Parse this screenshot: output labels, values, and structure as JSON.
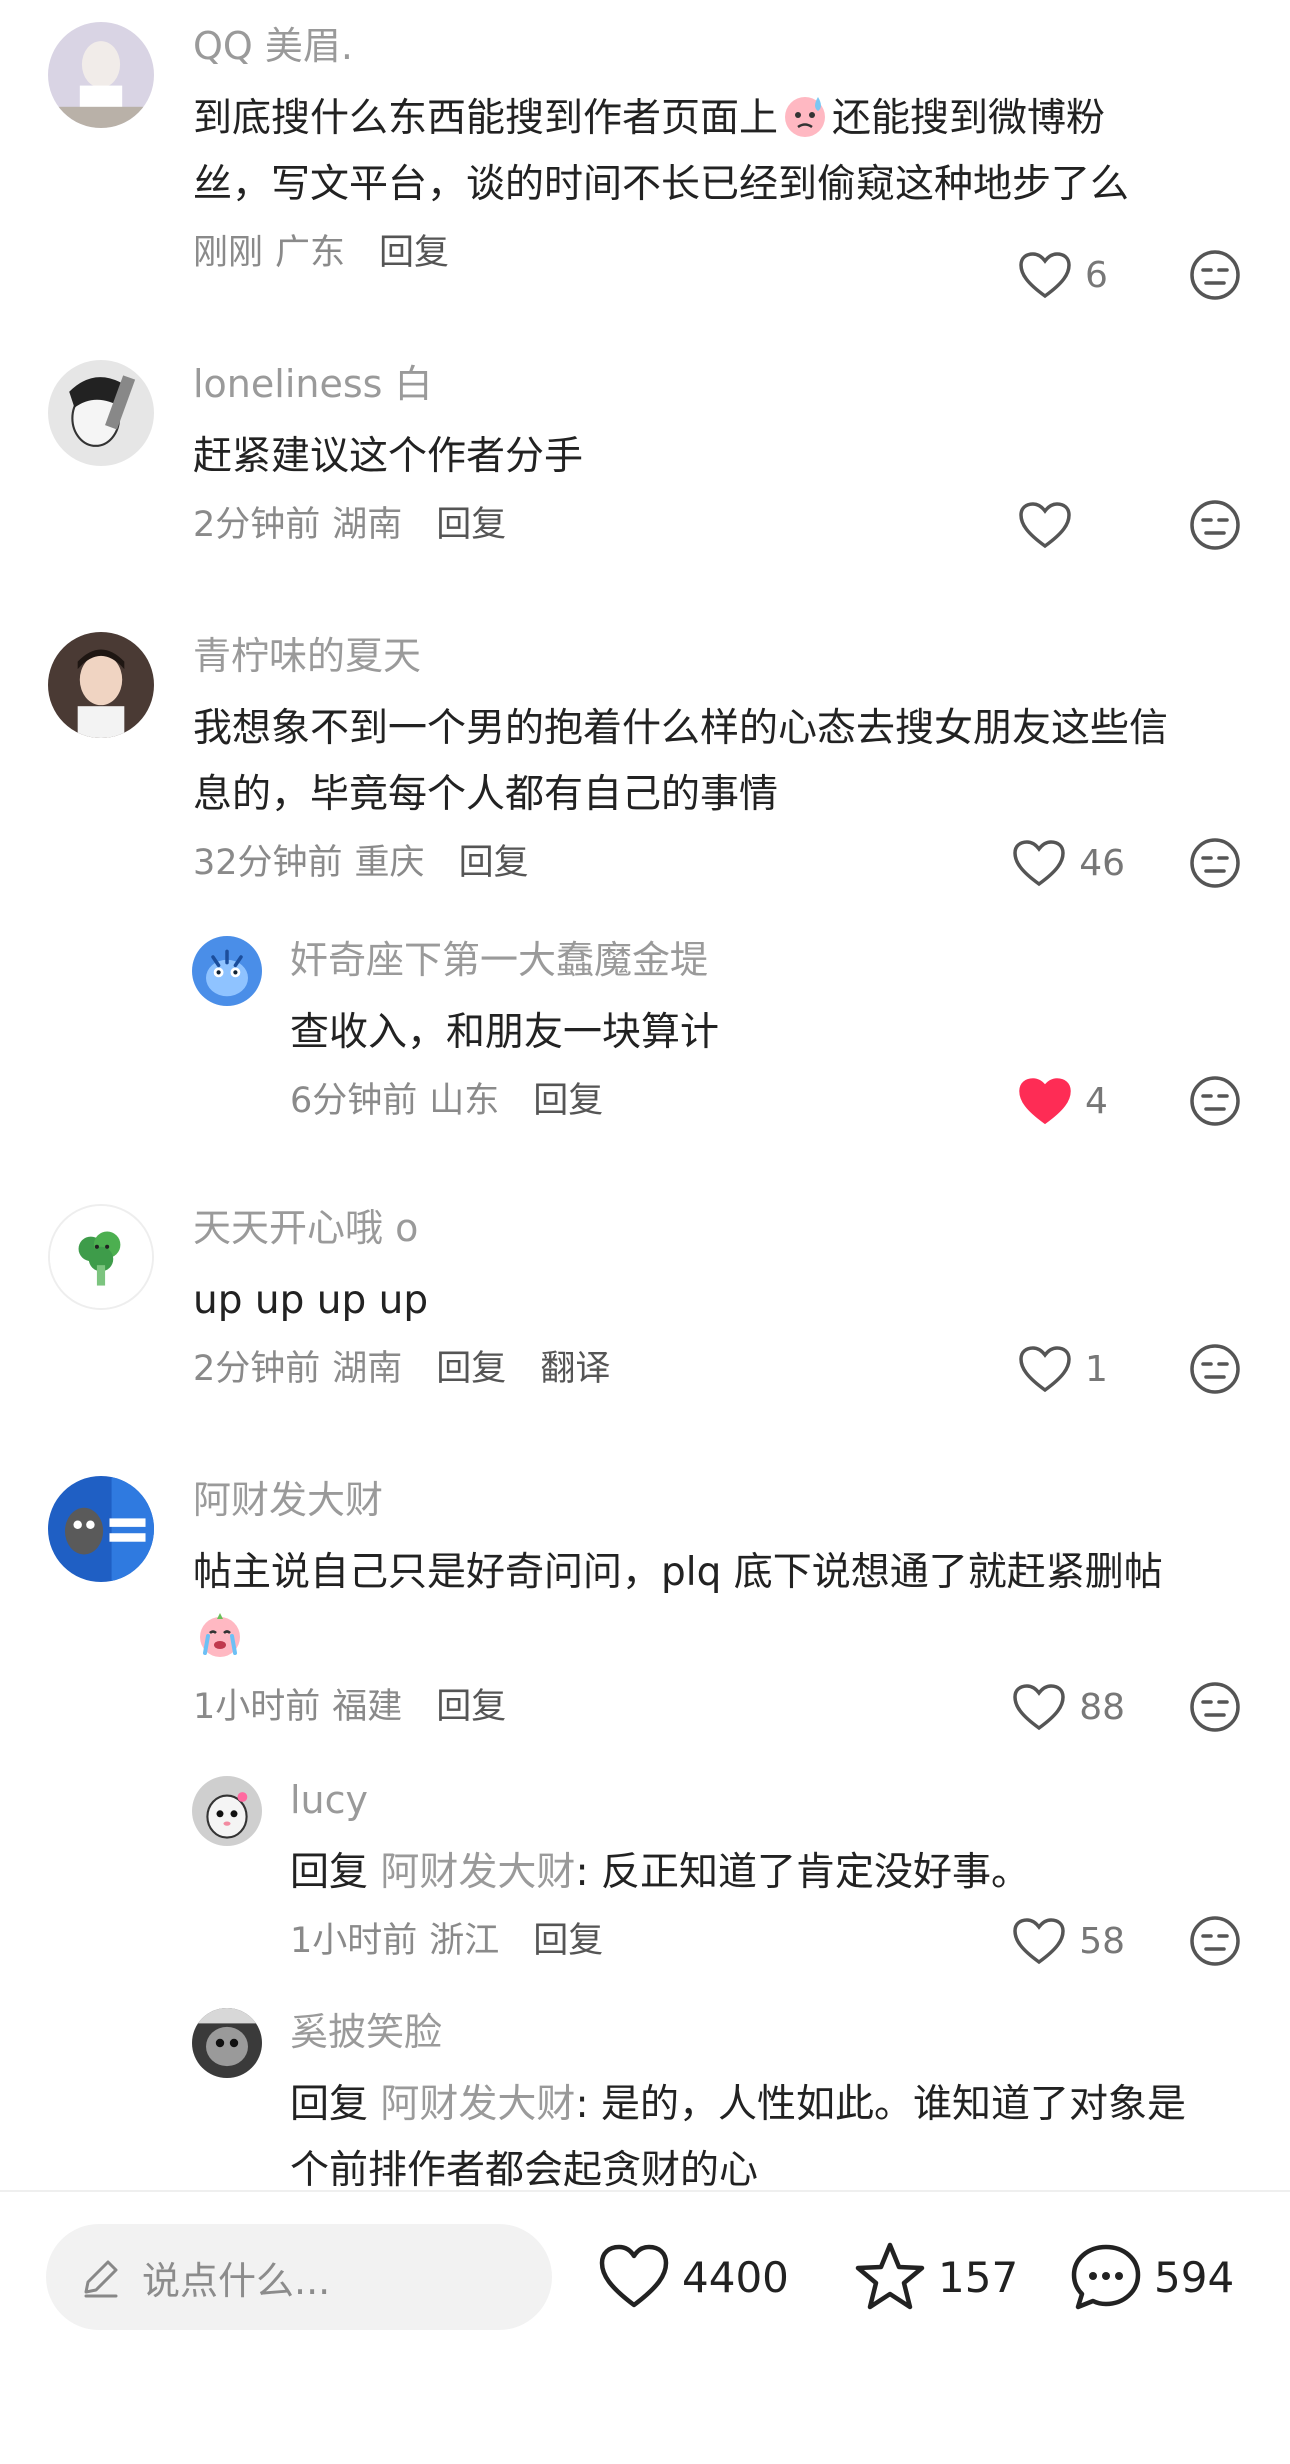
{
  "comments": [
    {
      "username": "QQ 美眉.",
      "text_line1_a": "到底搜什么东西能搜到作者页面上",
      "text_line1_b": "还能搜到微博粉",
      "text_line2": "丝，写文平台，谈的时间不长已经到偷窥这种地步了么",
      "time": "刚刚",
      "location": "广东",
      "reply_label": "回复",
      "likes": "6"
    },
    {
      "username": "loneliness 白",
      "text": "赶紧建议这个作者分手",
      "time": "2分钟前",
      "location": "湖南",
      "reply_label": "回复",
      "likes": ""
    },
    {
      "username": "青柠味的夏天",
      "text_line1": "我想象不到一个男的抱着什么样的心态去搜女朋友这些信",
      "text_line2": "息的，毕竟每个人都有自己的事情",
      "time": "32分钟前",
      "location": "重庆",
      "reply_label": "回复",
      "likes": "46"
    },
    {
      "username": "奸奇座下第一大蠢魔金堤",
      "text": "查收入，和朋友一块算计",
      "time": "6分钟前",
      "location": "山东",
      "reply_label": "回复",
      "likes": "4",
      "liked": true
    },
    {
      "username": "天天开心哦 o",
      "text": "up up up up",
      "time": "2分钟前",
      "location": "湖南",
      "reply_label": "回复",
      "translate_label": "翻译",
      "likes": "1"
    },
    {
      "username": "阿财发大财",
      "text": "帖主说自己只是好奇问问，plq 底下说想通了就赶紧删帖",
      "time": "1小时前",
      "location": "福建",
      "reply_label": "回复",
      "likes": "88"
    },
    {
      "username": "lucy",
      "reply_prefix": "回复",
      "mention": "阿财发大财",
      "text": ": 反正知道了肯定没好事。",
      "time": "1小时前",
      "location": "浙江",
      "reply_label": "回复",
      "likes": "58"
    },
    {
      "username": "奚披笑脸",
      "reply_prefix": "回复",
      "mention": "阿财发大财",
      "text_line1": ": 是的，人性如此。谁知道了对象是",
      "text_line2": "个前排作者都会起贪财的心"
    }
  ],
  "bottom_bar": {
    "input_placeholder": "说点什么...",
    "likes": "4400",
    "favorites": "157",
    "comments": "594"
  },
  "colors": {
    "liked_heart": "#fe2c55",
    "muted_text": "#9a9a9a",
    "input_bg": "#f2f2f2"
  }
}
